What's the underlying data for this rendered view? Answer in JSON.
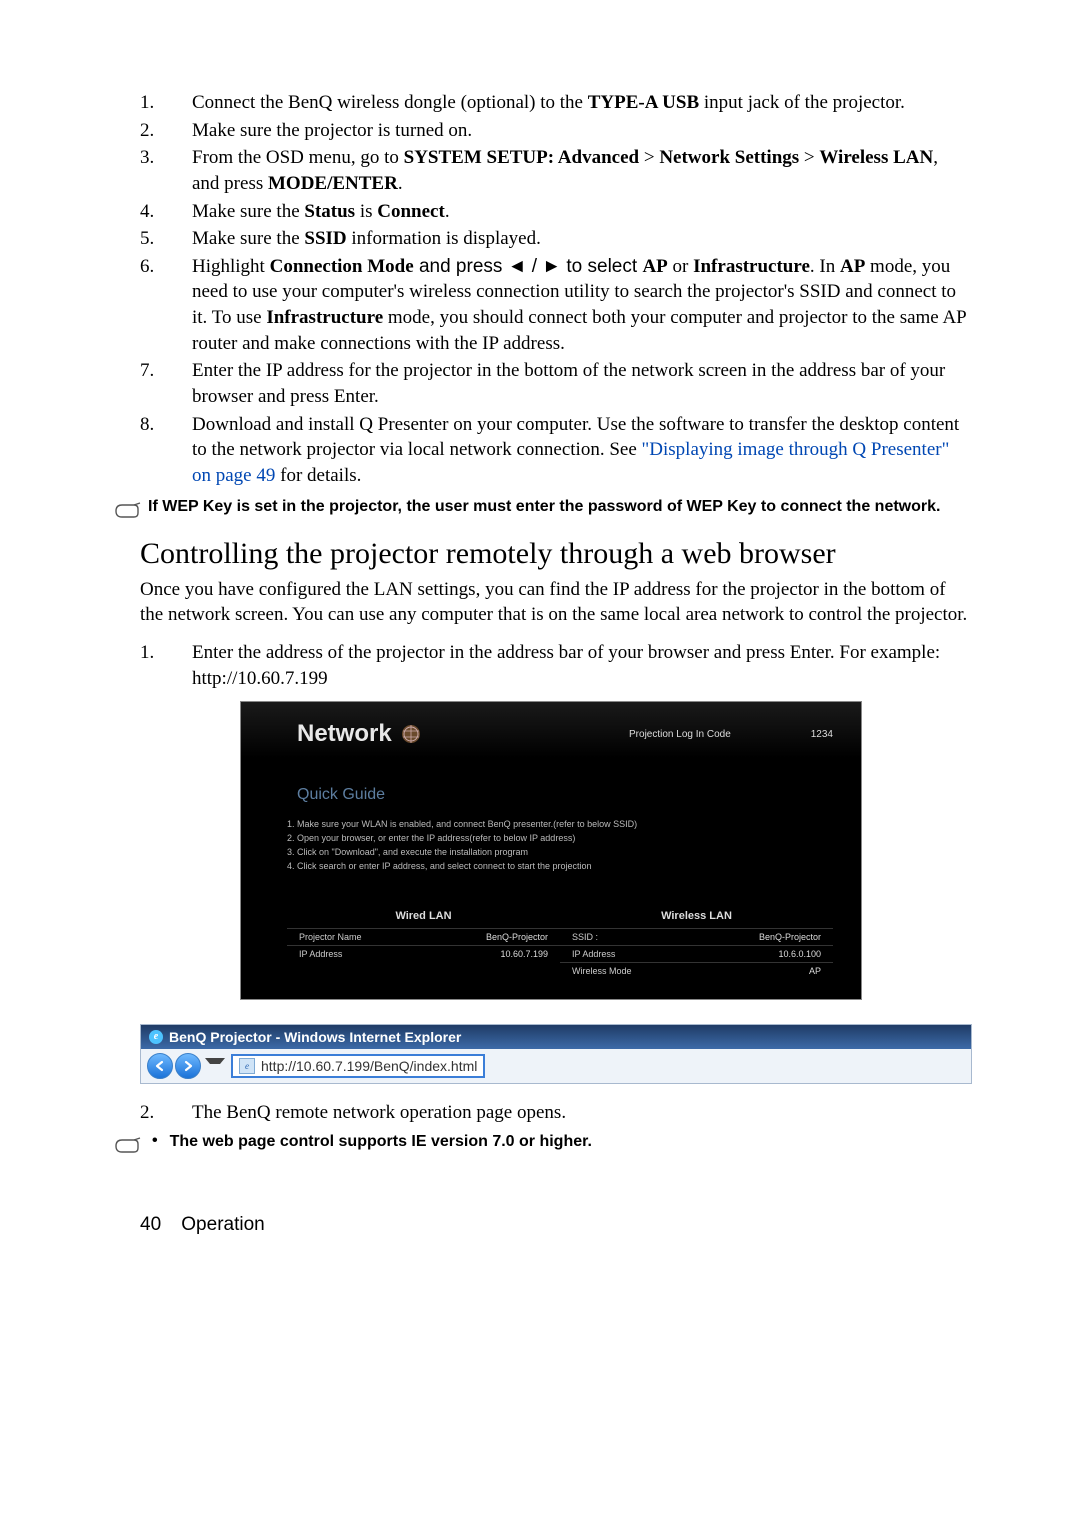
{
  "steps": {
    "s1a": "Connect the BenQ wireless dongle (optional) to the ",
    "s1b": "TYPE-A USB",
    "s1c": " input jack of the projector.",
    "s2": "Make sure the projector is turned on.",
    "s3a": "From the OSD menu, go to ",
    "s3b": "SYSTEM SETUP: Advanced",
    "s3c": " > ",
    "s3d": "Network Settings",
    "s3e": " > ",
    "s3f": "Wireless LAN",
    "s3g": ", and press ",
    "s3h": "MODE/ENTER",
    "s3i": ".",
    "s4a": "Make sure the ",
    "s4b": "Status",
    "s4c": " is ",
    "s4d": "Connect",
    "s4e": ".",
    "s5a": "Make sure the ",
    "s5b": "SSID",
    "s5c": " information is displayed.",
    "s6a": "Highlight ",
    "s6b": "Connection Mode",
    "s6c": " and press  ◄ / ►  to select ",
    "s6d": "AP",
    "s6e": " or ",
    "s6f": "Infrastructure",
    "s6g": ". In ",
    "s6h": "AP",
    "s6i": " mode, you need to use your computer's wireless connection utility to search the projector's SSID and connect to it. To use ",
    "s6j": "Infrastructure",
    "s6k": " mode, you should connect both your computer and projector to the same AP router and make connections with the IP address.",
    "s7": "Enter the IP address for the projector in the bottom of the network screen in the address bar of your browser and press Enter.",
    "s8a": "Download and install Q Presenter on your computer. Use the software to transfer the desktop content to the network projector via local network connection. See ",
    "s8b": "\"Displaying image through Q Presenter\" on page 49",
    "s8c": " for details."
  },
  "note1": "If WEP Key is set in the projector, the user must enter the password of WEP Key to connect the network.",
  "heading": "Controlling the projector remotely through a web browser",
  "intro": "Once you have configured the LAN settings, you can find the IP address for the projector in the bottom of the network screen. You can use any computer that is on the same local area network to control the projector.",
  "stepsB": {
    "b1": "Enter the address of the projector in the address bar of your browser and press Enter. For example: http://10.60.7.199",
    "b2": "The BenQ remote network operation page opens."
  },
  "screenshot": {
    "title": "Network",
    "loginLabel": "Projection Log In Code",
    "loginCode": "1234",
    "quickGuide": "Quick Guide",
    "qg1": "1. Make sure your WLAN is enabled, and connect BenQ presenter.(refer to below SSID)",
    "qg2": "2. Open your browser, or enter the IP address(refer to below IP address)",
    "qg3": "3. Click on \"Download\", and execute the installation program",
    "qg4": "4. Click search or enter IP address, and select connect to start the projection",
    "wiredTitle": "Wired LAN",
    "wirelessTitle": "Wireless LAN",
    "projNameLabel": "Projector Name",
    "projNameVal": "BenQ-Projector",
    "ipLabel": "IP Address",
    "ipValWired": "10.60.7.199",
    "ssidLabel": "SSID :",
    "ssidVal": "BenQ-Projector",
    "ipValWireless": "10.6.0.100",
    "wmodeLabel": "Wireless Mode",
    "wmodeVal": "AP"
  },
  "ie": {
    "title": "BenQ Projector - Windows Internet Explorer",
    "url": "http://10.60.7.199/BenQ/index.html"
  },
  "note2": "The web page control supports IE version 7.0 or higher.",
  "footer": {
    "page": "40",
    "section": "Operation"
  }
}
